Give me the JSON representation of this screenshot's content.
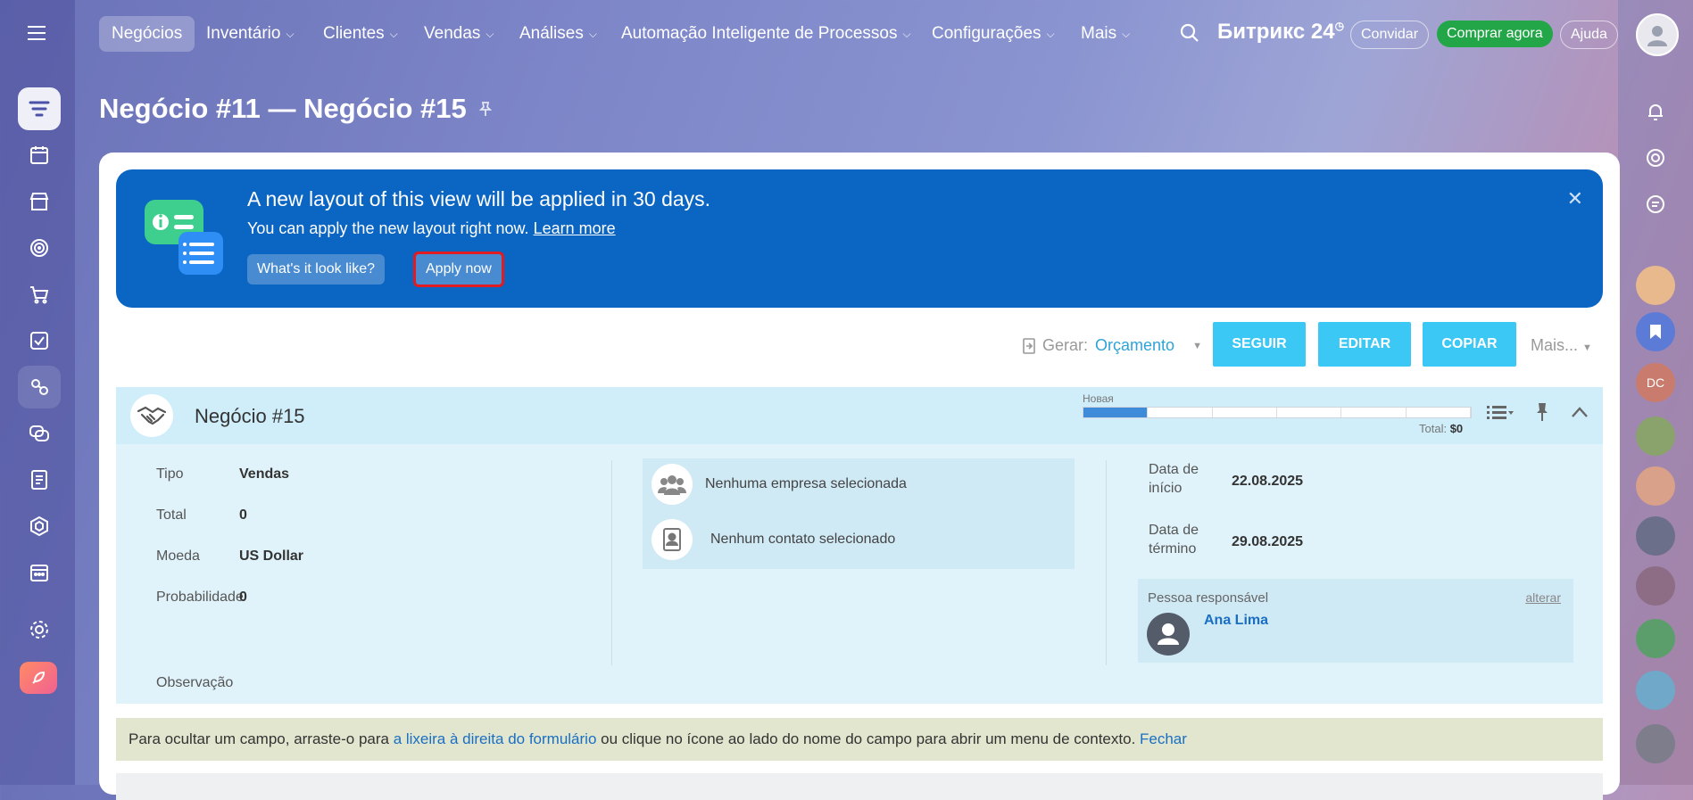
{
  "nav": {
    "items": [
      {
        "label": "Negócios",
        "active": true
      },
      {
        "label": "Inventário"
      },
      {
        "label": "Clientes"
      },
      {
        "label": "Vendas"
      },
      {
        "label": "Análises"
      },
      {
        "label": "Automação Inteligente de Processos"
      },
      {
        "label": "Configurações"
      },
      {
        "label": "Mais"
      }
    ],
    "brand": "Битрикс 24",
    "invite": "Convidar",
    "buy": "Comprar agora",
    "help": "Ajuda"
  },
  "page": {
    "title": "Negócio #11 — Negócio #15"
  },
  "banner": {
    "heading": "A new layout of this view will be applied in 30 days.",
    "subtext": "You can apply the new layout right now.",
    "learn_more": "Learn more",
    "preview_button": "What's it look like?",
    "apply_button": "Apply now"
  },
  "toolbar": {
    "generate_label": "Gerar:",
    "generate_value": "Orçamento",
    "follow": "SEGUIR",
    "edit": "EDITAR",
    "copy": "COPIAR",
    "more": "Mais..."
  },
  "deal": {
    "name": "Negócio #15",
    "stage": "Новая",
    "stage_progress": 0.167,
    "total_label": "Total:",
    "total_value": "$0",
    "fields": {
      "type_label": "Tipo",
      "type_value": "Vendas",
      "total_label": "Total",
      "total_value": "0",
      "currency_label": "Moeda",
      "currency_value": "US Dollar",
      "prob_label": "Probabilidade",
      "prob_value": "0",
      "notes_label": "Observação"
    },
    "client": {
      "company": "Nenhuma empresa selecionada",
      "contact": "Nenhum contato selecionado"
    },
    "dates": {
      "start_label_1": "Data de",
      "start_label_2": "início",
      "start_value": "22.08.2025",
      "end_label_1": "Data de",
      "end_label_2": "término",
      "end_value": "29.08.2025"
    },
    "responsible": {
      "label": "Pessoa responsável",
      "change": "alterar",
      "name": "Ana Lima"
    }
  },
  "hint": {
    "part1": "Para ocultar um campo, arraste-o para ",
    "link1": "a lixeira à direita do formulário",
    "part2": " ou clique no ícone ao lado do nome do campo para abrir um menu de contexto. ",
    "close": "Fechar"
  },
  "rightbar": {
    "initials": "DC"
  },
  "colors": {
    "banner": "#0b65c2",
    "accent": "#3bc8f5",
    "green": "#22a648",
    "highlight": "#e11b22"
  }
}
